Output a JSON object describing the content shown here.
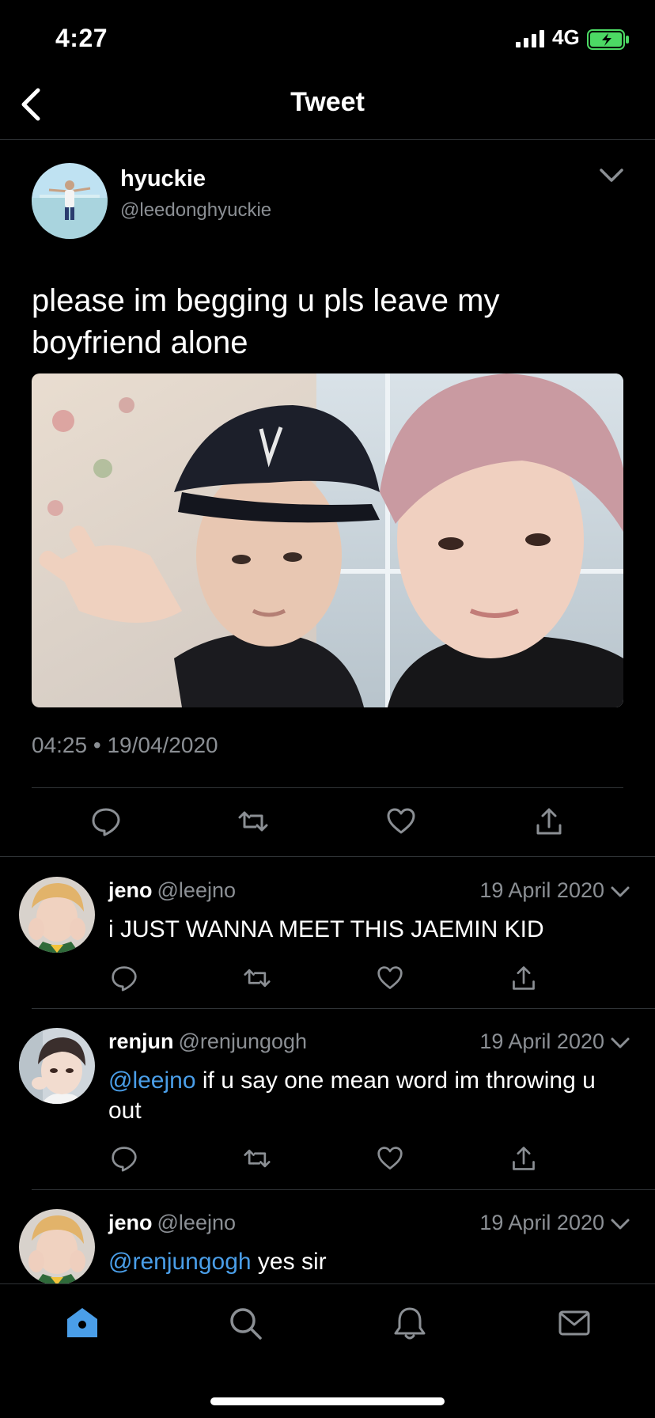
{
  "status_bar": {
    "time": "4:27",
    "network": "4G"
  },
  "header": {
    "title": "Tweet"
  },
  "tweet": {
    "author_name": "hyuckie",
    "author_handle": "@leedonghyuckie",
    "text": "please im begging u pls leave my boyfriend alone",
    "time": "04:25",
    "separator": "•",
    "date": "19/04/2020"
  },
  "replies": [
    {
      "name": "jeno",
      "handle": "@leejno",
      "date": "19 April 2020",
      "mention": "",
      "text": "i JUST WANNA MEET THIS JAEMIN KID"
    },
    {
      "name": "renjun",
      "handle": "@renjungogh",
      "date": "19 April 2020",
      "mention": "@leejno",
      "text": " if u say one mean word im throwing u out"
    },
    {
      "name": "jeno",
      "handle": "@leejno",
      "date": "19 April 2020",
      "mention": "@renjungogh",
      "text": " yes sir"
    }
  ],
  "tabs": [
    "home-icon",
    "search-icon",
    "notifications-icon",
    "messages-icon"
  ],
  "colors": {
    "accent": "#4a9ee8",
    "muted": "#8b8f94",
    "divider": "#2f3336",
    "battery": "#4cd964"
  }
}
